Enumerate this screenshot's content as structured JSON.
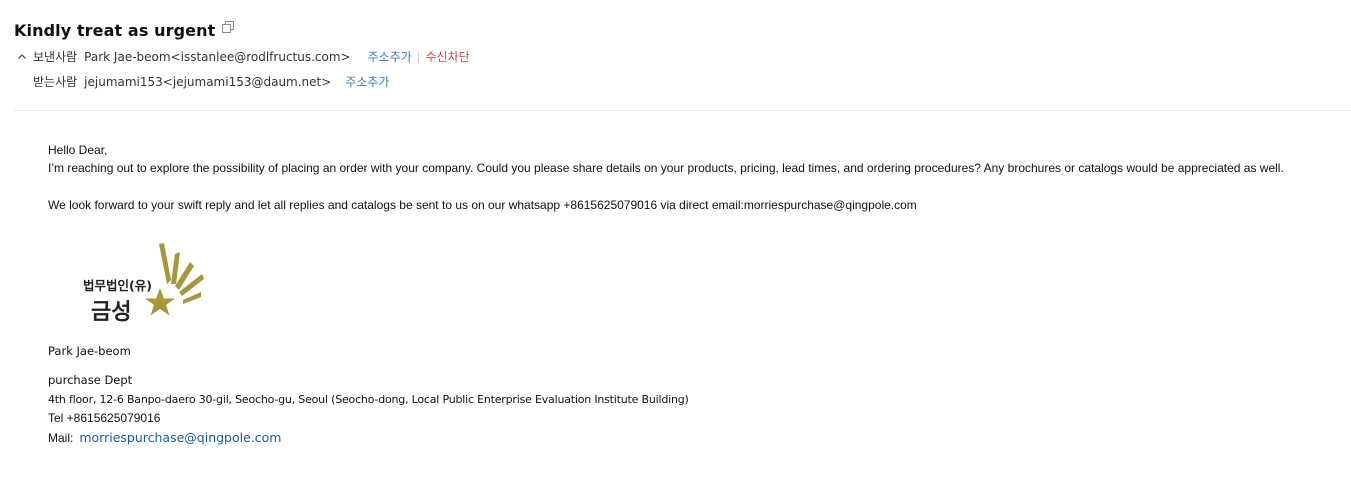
{
  "mail": {
    "subject": "Kindly treat as urgent",
    "sender": {
      "label": "보낸사람",
      "address": "Park Jae-beom<isstanlee@rodlfructus.com>",
      "add_address": "주소추가",
      "block": "수신차단"
    },
    "recipient": {
      "label": "받는사람",
      "address": "jejumami153<jejumami153@daum.net>",
      "add_address": "주소추가"
    }
  },
  "body": {
    "greeting": "Hello Dear,",
    "paragraph1": "I’m reaching out to explore the possibility of placing an order with your company. Could you please share details on your products, pricing, lead times, and ordering procedures? Any brochures or catalogs would be appreciated as well.",
    "paragraph2": "We look forward to your swift reply and let all replies and catalogs be sent to us  on our whatsapp +8615625079016 via direct email:morriespurchase@qingpole.com"
  },
  "signature": {
    "logo_text_top": "법무법인(유)",
    "logo_text_main": "금성",
    "name": "Park Jae-beom",
    "dept": "purchase Dept",
    "address": "4th floor, 12-6 Banpo-daero 30-gil, Seocho-gu, Seoul (Seocho-dong, Local Public Enterprise Evaluation Institute Building)",
    "tel": "Tel +8615625079016",
    "mail_label": "Mail:",
    "mail_address": "morriespurchase@qingpole.com"
  },
  "colors": {
    "link": "#3a7cc2",
    "block": "#d64545",
    "logo_gold": "#a8963a",
    "mail_link": "#1d5aa8"
  },
  "icons": {
    "copy": "copy-icon",
    "collapse": "chevron-up-icon"
  }
}
